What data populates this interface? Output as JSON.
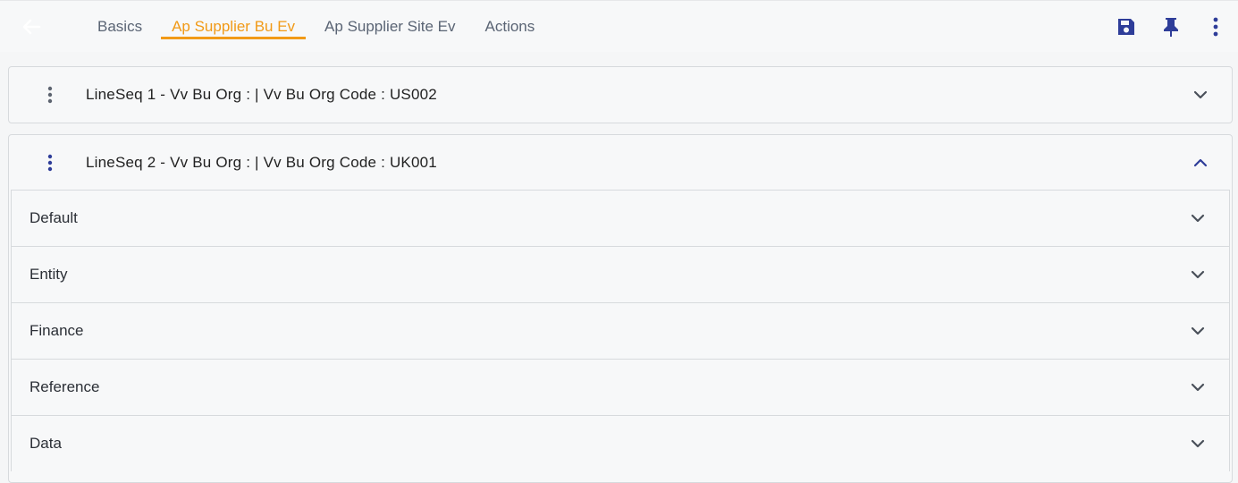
{
  "header": {
    "tabs": [
      {
        "label": "Basics"
      },
      {
        "label": "Ap Supplier Bu Ev"
      },
      {
        "label": "Ap Supplier Site Ev"
      },
      {
        "label": "Actions"
      }
    ],
    "active_tab": "Ap Supplier Bu Ev"
  },
  "lines": [
    {
      "title": "LineSeq 1 - Vv Bu Org  :  | Vv Bu Org Code  : US002",
      "expanded": false
    },
    {
      "title": "LineSeq 2 - Vv Bu Org  :  | Vv Bu Org Code  : UK001",
      "expanded": true
    }
  ],
  "sections": [
    {
      "label": "Default"
    },
    {
      "label": "Entity"
    },
    {
      "label": "Finance"
    },
    {
      "label": "Reference"
    },
    {
      "label": "Data"
    }
  ],
  "colors": {
    "accent": "#f19a17",
    "primary_icon": "#2e3d99",
    "muted_icon": "#5d6470"
  },
  "icons": {
    "back": "arrow-left-icon",
    "save": "save-icon",
    "pin": "pin-icon",
    "more": "more-vertical-icon"
  }
}
